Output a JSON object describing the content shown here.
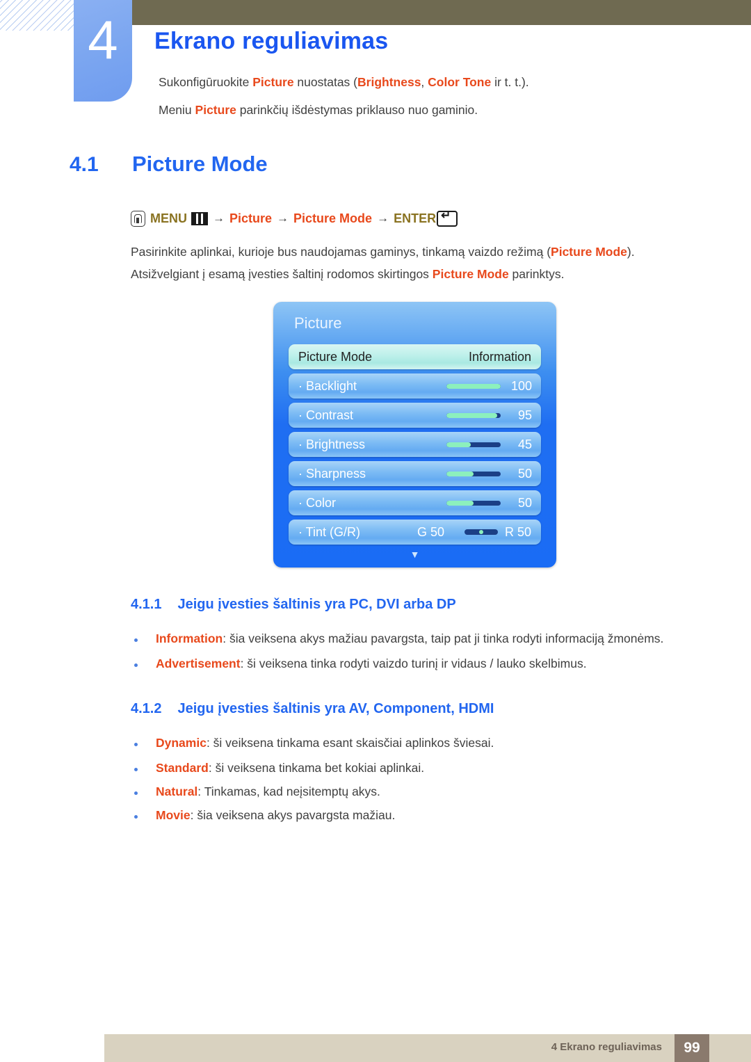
{
  "header": {
    "chapter_number": "4",
    "chapter_title": "Ekrano reguliavimas",
    "intro_line1_pre": "Sukonfigūruokite ",
    "intro_line1_kw1": "Picture",
    "intro_line1_mid": " nuostatas (",
    "intro_line1_kw2": "Brightness",
    "intro_line1_mid2": ", ",
    "intro_line1_kw3": "Color Tone",
    "intro_line1_post": " ir t. t.).",
    "intro_line2_pre": "Meniu ",
    "intro_line2_kw": "Picture",
    "intro_line2_post": " parinkčių išdėstymas priklauso nuo gaminio."
  },
  "section": {
    "number": "4.1",
    "title": "Picture Mode"
  },
  "menu_path": {
    "menu_label": "MENU",
    "arrow": "→",
    "step1": "Picture",
    "step2": "Picture Mode",
    "enter_label": "ENTER",
    "button_icon": "press-button-icon",
    "menu_icon": "menu-grid-icon",
    "enter_icon": "enter-key-icon"
  },
  "description": {
    "line1_pre": "Pasirinkite aplinkai, kurioje bus naudojamas gaminys, tinkamą vaizdo režimą (",
    "line1_kw": "Picture Mode",
    "line1_post": ").",
    "line2_pre": "Atsižvelgiant į esamą įvesties šaltinį rodomos skirtingos ",
    "line2_kw": "Picture Mode",
    "line2_post": " parinktys."
  },
  "osd": {
    "title": "Picture",
    "chevron": "▼",
    "rows": [
      {
        "label": "Picture Mode",
        "value": "Information",
        "type": "value",
        "selected": true
      },
      {
        "label": "· Backlight",
        "value": "100",
        "type": "slider",
        "fill_pct": 100
      },
      {
        "label": "· Contrast",
        "value": "95",
        "type": "slider",
        "fill_pct": 93
      },
      {
        "label": "· Brightness",
        "value": "45",
        "type": "slider",
        "fill_pct": 45
      },
      {
        "label": "· Sharpness",
        "value": "50",
        "type": "slider",
        "fill_pct": 50
      },
      {
        "label": "· Color",
        "value": "50",
        "type": "slider",
        "fill_pct": 50
      },
      {
        "label": "· Tint (G/R)",
        "value_g": "G 50",
        "value_r": "R 50",
        "type": "tint"
      }
    ]
  },
  "subsection1": {
    "number": "4.1.1",
    "title": "Jeigu įvesties šaltinis yra PC, DVI arba DP",
    "items": [
      {
        "term": "Information",
        "desc": ": šia veiksena akys mažiau pavargsta, taip pat ji tinka rodyti informaciją žmonėms."
      },
      {
        "term": "Advertisement",
        "desc": ": ši veiksena tinka rodyti vaizdo turinį ir vidaus / lauko skelbimus."
      }
    ]
  },
  "subsection2": {
    "number": "4.1.2",
    "title": "Jeigu įvesties šaltinis yra AV, Component, HDMI",
    "items": [
      {
        "term": "Dynamic",
        "desc": ": ši veiksena tinkama esant skaisčiai aplinkos šviesai."
      },
      {
        "term": "Standard",
        "desc": ": ši veiksena tinkama bet kokiai aplinkai."
      },
      {
        "term": "Natural",
        "desc": ": Tinkamas, kad neįsitemptų akys."
      },
      {
        "term": "Movie",
        "desc": ": šia veiksena akys pavargsta mažiau."
      }
    ]
  },
  "footer": {
    "text": "4 Ekrano reguliavimas",
    "page": "99"
  },
  "colors": {
    "accent_blue": "#2266f0",
    "keyword_orange": "#e8491c",
    "olive_bar": "#6f6a51",
    "menu_olive": "#8a7322",
    "footer_beige": "#d9d2c0",
    "footer_page_brown": "#8a7a6d",
    "osd_green": "#8cf0bd"
  }
}
